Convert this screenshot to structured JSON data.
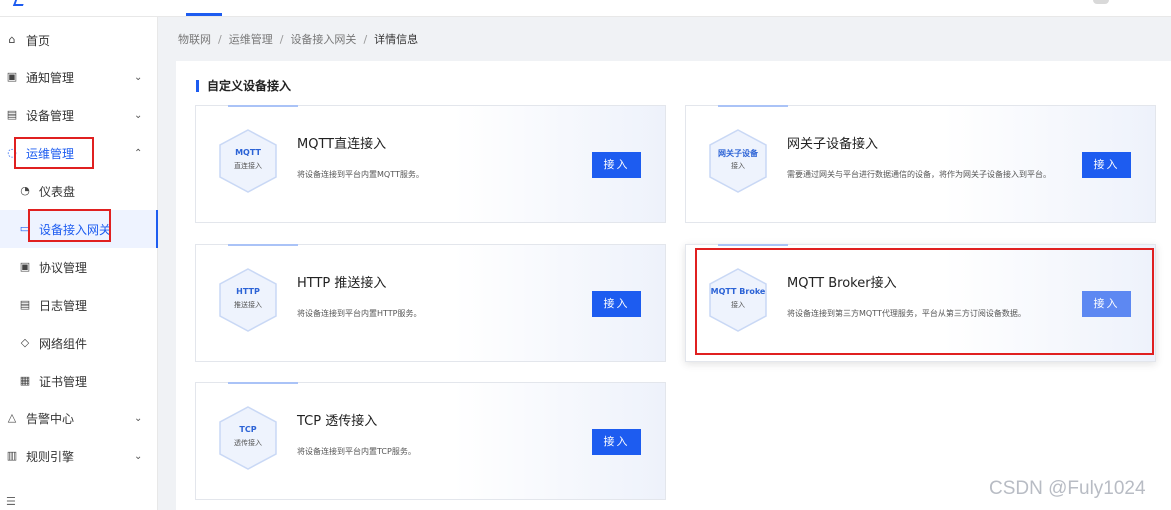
{
  "sidebar": {
    "items": [
      {
        "label": "首页",
        "icon": "home-icon",
        "glyph": "⌂"
      },
      {
        "label": "通知管理",
        "icon": "notice-icon",
        "glyph": "▣",
        "chevron": "⌄"
      },
      {
        "label": "设备管理",
        "icon": "device-icon",
        "glyph": "▤",
        "chevron": "⌄"
      },
      {
        "label": "运维管理",
        "icon": "ops-icon",
        "glyph": "◌",
        "chevron": "⌃"
      },
      {
        "label": "仪表盘",
        "icon": "dashboard-icon",
        "glyph": "◔"
      },
      {
        "label": "设备接入网关",
        "icon": "gateway-icon",
        "glyph": "▭"
      },
      {
        "label": "协议管理",
        "icon": "protocol-icon",
        "glyph": "▣"
      },
      {
        "label": "日志管理",
        "icon": "log-icon",
        "glyph": "▤"
      },
      {
        "label": "网络组件",
        "icon": "network-icon",
        "glyph": "◇"
      },
      {
        "label": "证书管理",
        "icon": "cert-icon",
        "glyph": "▦"
      },
      {
        "label": "告警中心",
        "icon": "alarm-icon",
        "glyph": "△",
        "chevron": "⌄"
      },
      {
        "label": "规则引擎",
        "icon": "rule-icon",
        "glyph": "▥",
        "chevron": "⌄"
      }
    ],
    "collapse_glyph": "☰"
  },
  "breadcrumb": [
    "物联网",
    "运维管理",
    "设备接入网关",
    "详情信息"
  ],
  "breadcrumb_sep": "/",
  "section_title": "自定义设备接入",
  "cards": [
    {
      "hex_title": "MQTT",
      "hex_sub": "直连接入",
      "title": "MQTT直连接入",
      "desc": "将设备连接到平台内置MQTT服务。",
      "button": "接入"
    },
    {
      "hex_title": "网关子设备",
      "hex_sub": "接入",
      "title": "网关子设备接入",
      "desc": "需要通过网关与平台进行数据通信的设备，将作为网关子设备接入到平台。",
      "button": "接入"
    },
    {
      "hex_title": "HTTP",
      "hex_sub": "推送接入",
      "title": "HTTP 推送接入",
      "desc": "将设备连接到平台内置HTTP服务。",
      "button": "接入"
    },
    {
      "hex_title": "MQTT Broke",
      "hex_sub": "接入",
      "title": "MQTT Broker接入",
      "desc": "将设备连接到第三方MQTT代理服务，平台从第三方订阅设备数据。",
      "button": "接入"
    },
    {
      "hex_title": "TCP",
      "hex_sub": "透传接入",
      "title": "TCP 透传接入",
      "desc": "将设备连接到平台内置TCP服务。",
      "button": "接入"
    }
  ],
  "watermark": "CSDN @Fuly1024",
  "colors": {
    "accent": "#1d5cf0",
    "highlight_box": "#e02020"
  }
}
